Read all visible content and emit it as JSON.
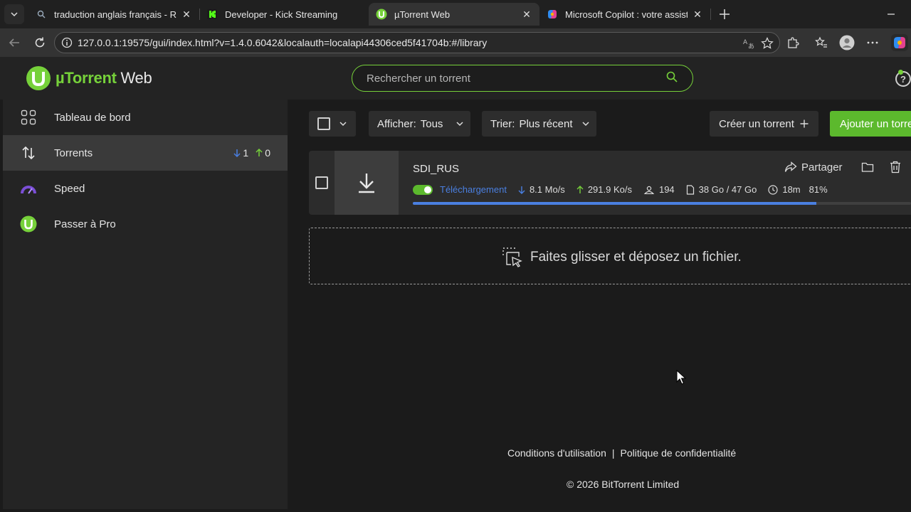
{
  "browser": {
    "tabs": [
      {
        "title": "traduction anglais français - Reche",
        "icon": "search-icon"
      },
      {
        "title": "Developer - Kick Streaming",
        "icon": "kick-logo-icon"
      },
      {
        "title": "µTorrent Web",
        "icon": "utorrent-logo-icon"
      },
      {
        "title": "Microsoft Copilot : votre assistant",
        "icon": "copilot-logo-icon"
      }
    ],
    "url": "127.0.0.1:19575/gui/index.html?v=1.4.0.6042&localauth=localapi44306ced5f41704b:#/library"
  },
  "app": {
    "logo_mu": "µTorrent",
    "logo_web": " Web",
    "search_placeholder": "Rechercher un torrent",
    "help_label": "?"
  },
  "sidebar": {
    "items": [
      {
        "label": "Tableau de bord",
        "icon": "dashboard-grid-icon"
      },
      {
        "label": "Torrents",
        "icon": "up-down-arrows-icon"
      },
      {
        "label": "Speed",
        "icon": "speedometer-icon"
      },
      {
        "label": "Passer à Pro",
        "icon": "utorrent-pro-icon"
      }
    ],
    "torrent_counts": {
      "down": "1",
      "up": "0"
    }
  },
  "toolbar": {
    "filter_label": "Afficher:",
    "filter_value": "Tous",
    "sort_label": "Trier:",
    "sort_value": "Plus récent",
    "create_label": "Créer un torrent",
    "add_label": "Ajouter un torre"
  },
  "torrent": {
    "name": "SDI_RUS",
    "share_label": "Partager",
    "status": "Téléchargement",
    "down_speed": "8.1 Mo/s",
    "up_speed": "291.9 Ko/s",
    "peers": "194",
    "size": "38 Go / 47 Go",
    "eta": "18m",
    "percent": "81%",
    "progress": 0.81
  },
  "dropzone": {
    "text": "Faites glisser et déposez un fichier."
  },
  "footer": {
    "terms": "Conditions d'utilisation",
    "separator": "|",
    "privacy": "Politique de confidentialité",
    "copyright": "© 2026 BitTorrent Limited"
  },
  "colors": {
    "accent": "#76d13a",
    "progress": "#4a7fe0",
    "status": "#4a7fe0"
  }
}
